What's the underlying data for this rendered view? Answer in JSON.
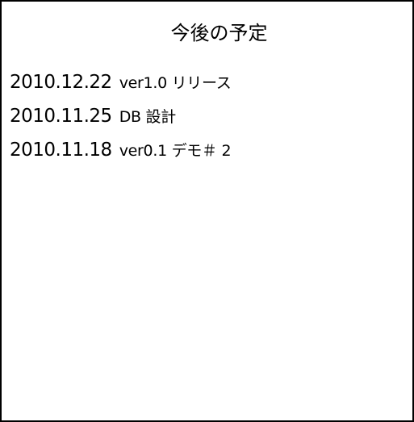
{
  "title": "今後の予定",
  "schedule": [
    {
      "date": "2010.12.22",
      "description": "ver1.0 リリース"
    },
    {
      "date": "2010.11.25",
      "description": "DB 設計"
    },
    {
      "date": "2010.11.18",
      "description": "ver0.1 デモ＃ 2"
    }
  ]
}
